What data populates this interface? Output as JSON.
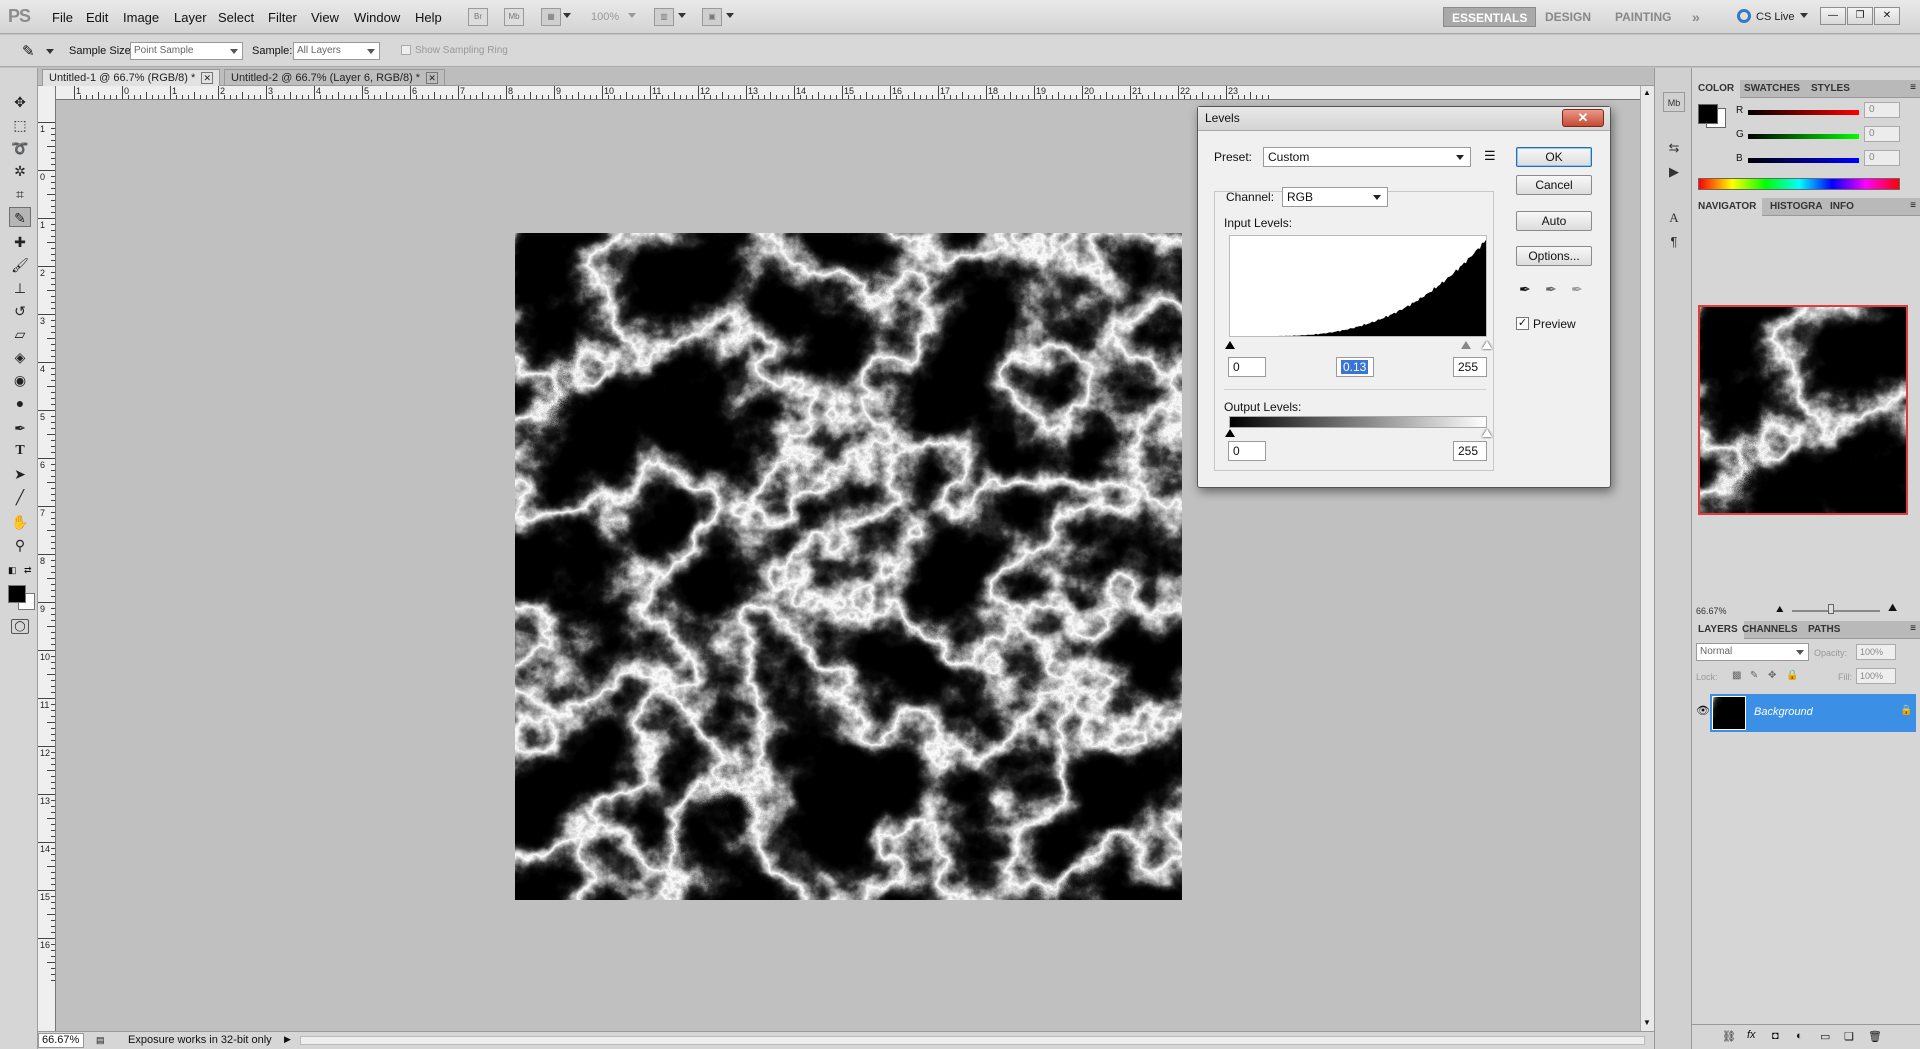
{
  "app": {
    "logo": "PS"
  },
  "menu": {
    "items": [
      "File",
      "Edit",
      "Image",
      "Layer",
      "Select",
      "Filter",
      "View",
      "Window",
      "Help"
    ],
    "zoom": "100%"
  },
  "workspaces": {
    "items": [
      "ESSENTIALS",
      "DESIGN",
      "PAINTING"
    ],
    "active": "ESSENTIALS",
    "more": "»",
    "cslive": "CS Live"
  },
  "options_bar": {
    "sample_size_label": "Sample Size:",
    "sample_size_value": "Point Sample",
    "sample_label": "Sample:",
    "sample_value": "All Layers",
    "sampling_ring_label": "Show Sampling Ring"
  },
  "tabs": [
    {
      "label": "Untitled-1 @ 66.7% (RGB/8) *",
      "active": true
    },
    {
      "label": "Untitled-2 @ 66.7% (Layer 6, RGB/8) *",
      "active": false
    }
  ],
  "ruler": {
    "top_labels": [
      "1",
      "0",
      "1",
      "2",
      "3",
      "4",
      "5",
      "6",
      "7",
      "8",
      "9",
      "10",
      "11",
      "12",
      "13",
      "14",
      "15",
      "16",
      "17",
      "18",
      "19",
      "20",
      "21",
      "22",
      "23"
    ],
    "left_labels": [
      "1",
      "0",
      "1",
      "2",
      "3",
      "4",
      "5",
      "6",
      "7",
      "8",
      "9",
      "10",
      "11",
      "12",
      "13",
      "14",
      "15",
      "16"
    ]
  },
  "status": {
    "zoom": "66.67%",
    "message": "Exposure works in 32-bit only"
  },
  "levels": {
    "title": "Levels",
    "close": "✕",
    "preset_label": "Preset:",
    "preset_value": "Custom",
    "channel_label": "Channel:",
    "channel_value": "RGB",
    "input_label": "Input Levels:",
    "input_black": "0",
    "input_gamma": "0.13",
    "input_white": "255",
    "output_label": "Output Levels:",
    "output_black": "0",
    "output_white": "255",
    "buttons": {
      "ok": "OK",
      "cancel": "Cancel",
      "auto": "Auto",
      "options": "Options..."
    },
    "preview_label": "Preview",
    "preview_checked": true
  },
  "color_panel": {
    "tabs": [
      "COLOR",
      "SWATCHES",
      "STYLES"
    ],
    "channels": [
      {
        "label": "R",
        "value": "0",
        "color": "#e00000"
      },
      {
        "label": "G",
        "value": "0",
        "color": "#00b000"
      },
      {
        "label": "B",
        "value": "0",
        "color": "#0000e0"
      }
    ]
  },
  "navigator_panel": {
    "tabs": [
      "NAVIGATOR",
      "HISTOGRA",
      "INFO"
    ],
    "zoom": "66.67%"
  },
  "layers_panel": {
    "tabs": [
      "LAYERS",
      "CHANNELS",
      "PATHS"
    ],
    "blend_mode": "Normal",
    "opacity_label": "Opacity:",
    "opacity_value": "100%",
    "lock_label": "Lock:",
    "fill_label": "Fill:",
    "fill_value": "100%",
    "layers": [
      {
        "name": "Background"
      }
    ]
  }
}
